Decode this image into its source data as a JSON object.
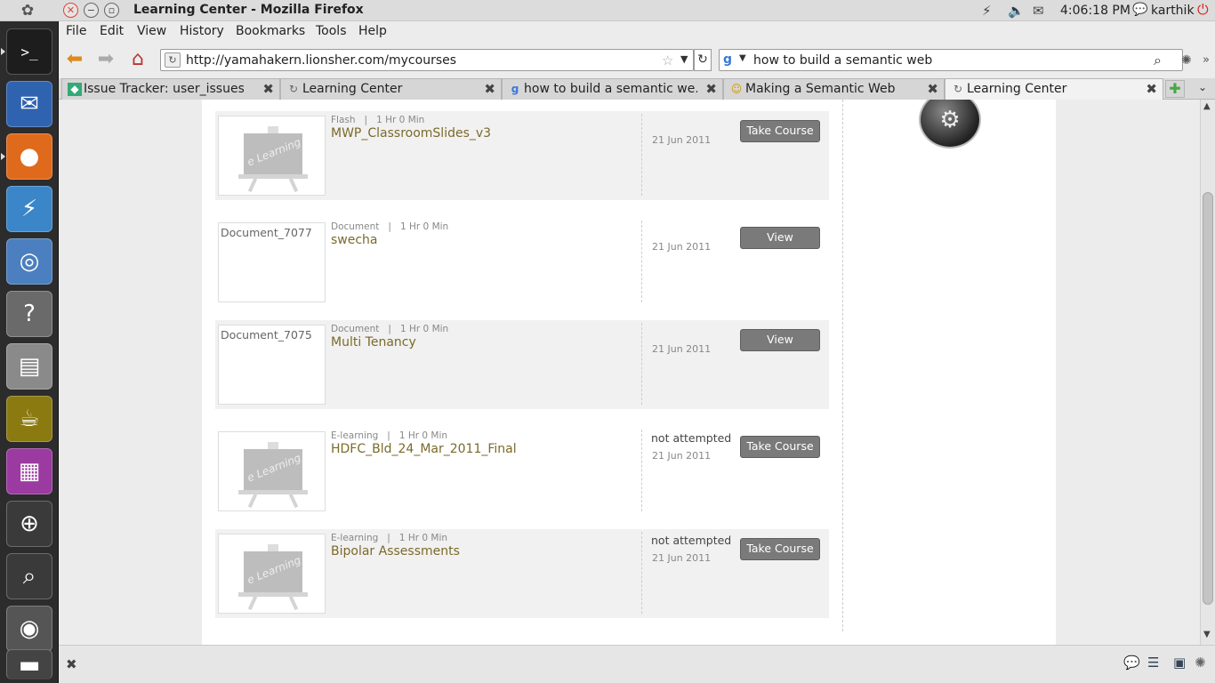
{
  "panel": {
    "window_title": "Learning Center - Mozilla Firefox",
    "clock": "4:06:18 PM",
    "user": "karthik"
  },
  "launcher": {
    "items": [
      "terminal-icon",
      "thunderbird-icon",
      "firefox-icon",
      "eclipse-icon",
      "chromium-icon",
      "help-icon",
      "files-icon",
      "genie-icon",
      "workspaces-icon",
      "zoom-icon",
      "search-icon",
      "drive-icon",
      "trash-icon"
    ]
  },
  "menubar": {
    "file": "File",
    "edit": "Edit",
    "view": "View",
    "history": "History",
    "bookmarks": "Bookmarks",
    "tools": "Tools",
    "help": "Help"
  },
  "navbar": {
    "url": "http://yamahakern.lionsher.com/mycourses",
    "search_query": "how to build a semantic web"
  },
  "tabs": [
    {
      "label": "Issue Tracker: user_issues",
      "active": false
    },
    {
      "label": "Learning Center",
      "active": false
    },
    {
      "label": "how to build a semantic we...",
      "active": false
    },
    {
      "label": "Making a Semantic Web",
      "active": false
    },
    {
      "label": "Learning Center",
      "active": true
    }
  ],
  "courses": [
    {
      "type": "Flash",
      "duration": "1 Hr 0 Min",
      "title": "MWP_ClassroomSlides_v3",
      "status": "",
      "date": "21 Jun 2011",
      "button": "Take Course",
      "thumb_text": "",
      "thumb_label": "e Learning"
    },
    {
      "type": "Document",
      "duration": "1 Hr 0 Min",
      "title": "swecha",
      "status": "",
      "date": "21 Jun 2011",
      "button": "View",
      "thumb_text": "Document_7077",
      "thumb_label": ""
    },
    {
      "type": "Document",
      "duration": "1 Hr 0 Min",
      "title": "Multi Tenancy",
      "status": "",
      "date": "21 Jun 2011",
      "button": "View",
      "thumb_text": "Document_7075",
      "thumb_label": ""
    },
    {
      "type": "E-learning",
      "duration": "1 Hr 0 Min",
      "title": "HDFC_Bld_24_Mar_2011_Final",
      "status": "not attempted",
      "date": "21 Jun 2011",
      "button": "Take Course",
      "thumb_text": "",
      "thumb_label": "e Learning"
    },
    {
      "type": "E-learning",
      "duration": "1 Hr 0 Min",
      "title": "Bipolar Assessments",
      "status": "not attempted",
      "date": "21 Jun 2011",
      "button": "Take Course",
      "thumb_text": "",
      "thumb_label": "e Learning"
    }
  ]
}
